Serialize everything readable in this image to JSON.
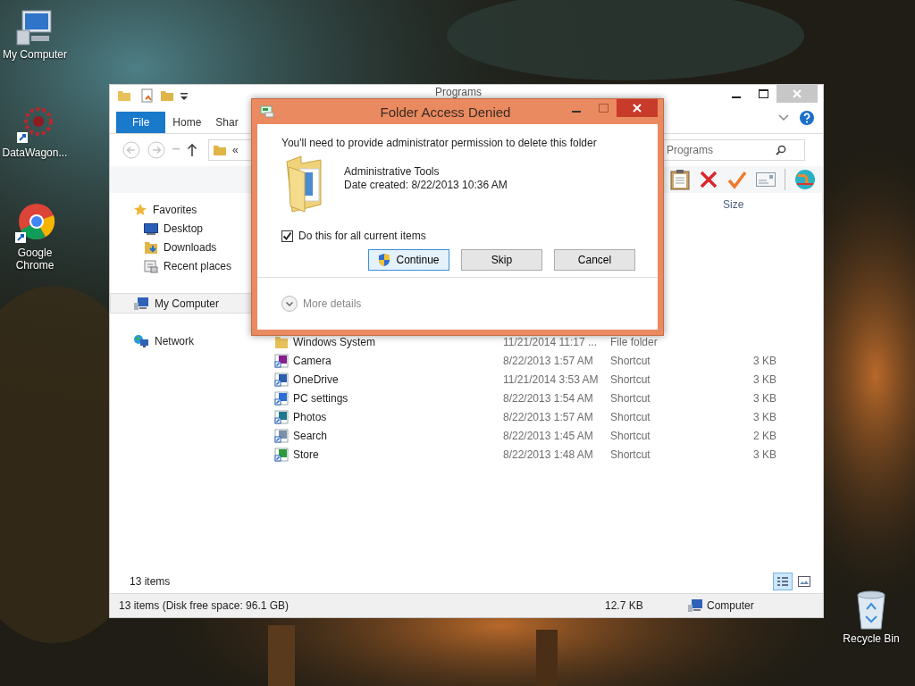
{
  "desktop_icons": [
    {
      "label": "My Computer",
      "kind": "computer"
    },
    {
      "label": "DataWagon...",
      "kind": "wagon"
    },
    {
      "label": "Google Chrome",
      "kind": "browser"
    },
    {
      "label": "Recycle Bin",
      "kind": "bin"
    }
  ],
  "explorer": {
    "title": "Programs",
    "ribbon_tabs": [
      {
        "label": "File",
        "selected": true
      },
      {
        "label": "Home",
        "selected": false
      },
      {
        "label": "Shar",
        "selected": false
      }
    ],
    "address": {
      "path": "«"
    },
    "search": {
      "placeholder": "Programs"
    },
    "columns": [
      {
        "label": "Size"
      }
    ],
    "nav": [
      {
        "label": "Favorites",
        "kind": "star",
        "selected": false,
        "children": [
          {
            "label": "Desktop",
            "kind": "desktop",
            "selected": false
          },
          {
            "label": "Downloads",
            "kind": "downloads",
            "selected": false
          },
          {
            "label": "Recent places",
            "kind": "recent",
            "selected": false
          }
        ]
      },
      {
        "label": "My Computer",
        "kind": "computer",
        "selected": true
      },
      {
        "label": "Network",
        "kind": "network",
        "selected": false
      }
    ],
    "rows": [
      {
        "name": "Windows System",
        "date": "11/21/2014 11:17 ...",
        "type": "File folder",
        "kind": "folder"
      },
      {
        "name": "Camera",
        "date": "8/22/2013 1:57 AM",
        "type": "Shortcut",
        "size": "3 KB",
        "kind": "camera"
      },
      {
        "name": "OneDrive",
        "date": "11/21/2014 3:53 AM",
        "type": "Shortcut",
        "size": "3 KB",
        "kind": "cloud"
      },
      {
        "name": "PC settings",
        "date": "8/22/2013 1:54 AM",
        "type": "Shortcut",
        "size": "3 KB",
        "kind": "gear"
      },
      {
        "name": "Photos",
        "date": "8/22/2013 1:57 AM",
        "type": "Shortcut",
        "size": "3 KB"
      },
      {
        "name": "Search",
        "date": "8/22/2013 1:45 AM",
        "type": "Shortcut",
        "size": "2 KB",
        "kind": "search"
      },
      {
        "name": "Store",
        "date": "8/22/2013 1:48 AM",
        "type": "Shortcut",
        "size": "3 KB",
        "kind": "store"
      }
    ],
    "item_count": "13 items",
    "view_buttons": [
      {
        "kind": "details",
        "selected": true
      },
      {
        "kind": "tiles",
        "selected": false
      }
    ],
    "status_bar": {
      "summary": "13 items (Disk free space: 96.1 GB)",
      "size": "12.7 KB",
      "location": "Computer"
    }
  },
  "dialog": {
    "title": "Folder Access Denied",
    "message": "You'll need to provide administrator permission to delete this folder",
    "item_name": "Administrative Tools",
    "item_date": "Date created: 8/22/2013 10:36 AM",
    "checkbox": {
      "label": "Do this for all current items",
      "checked": true
    },
    "buttons": [
      {
        "label": "Continue",
        "kind": "shield",
        "default": true
      },
      {
        "label": "Skip",
        "kind": "plain",
        "default": false
      },
      {
        "label": "Cancel",
        "kind": "plain",
        "default": false
      }
    ],
    "more_details": "More details"
  }
}
